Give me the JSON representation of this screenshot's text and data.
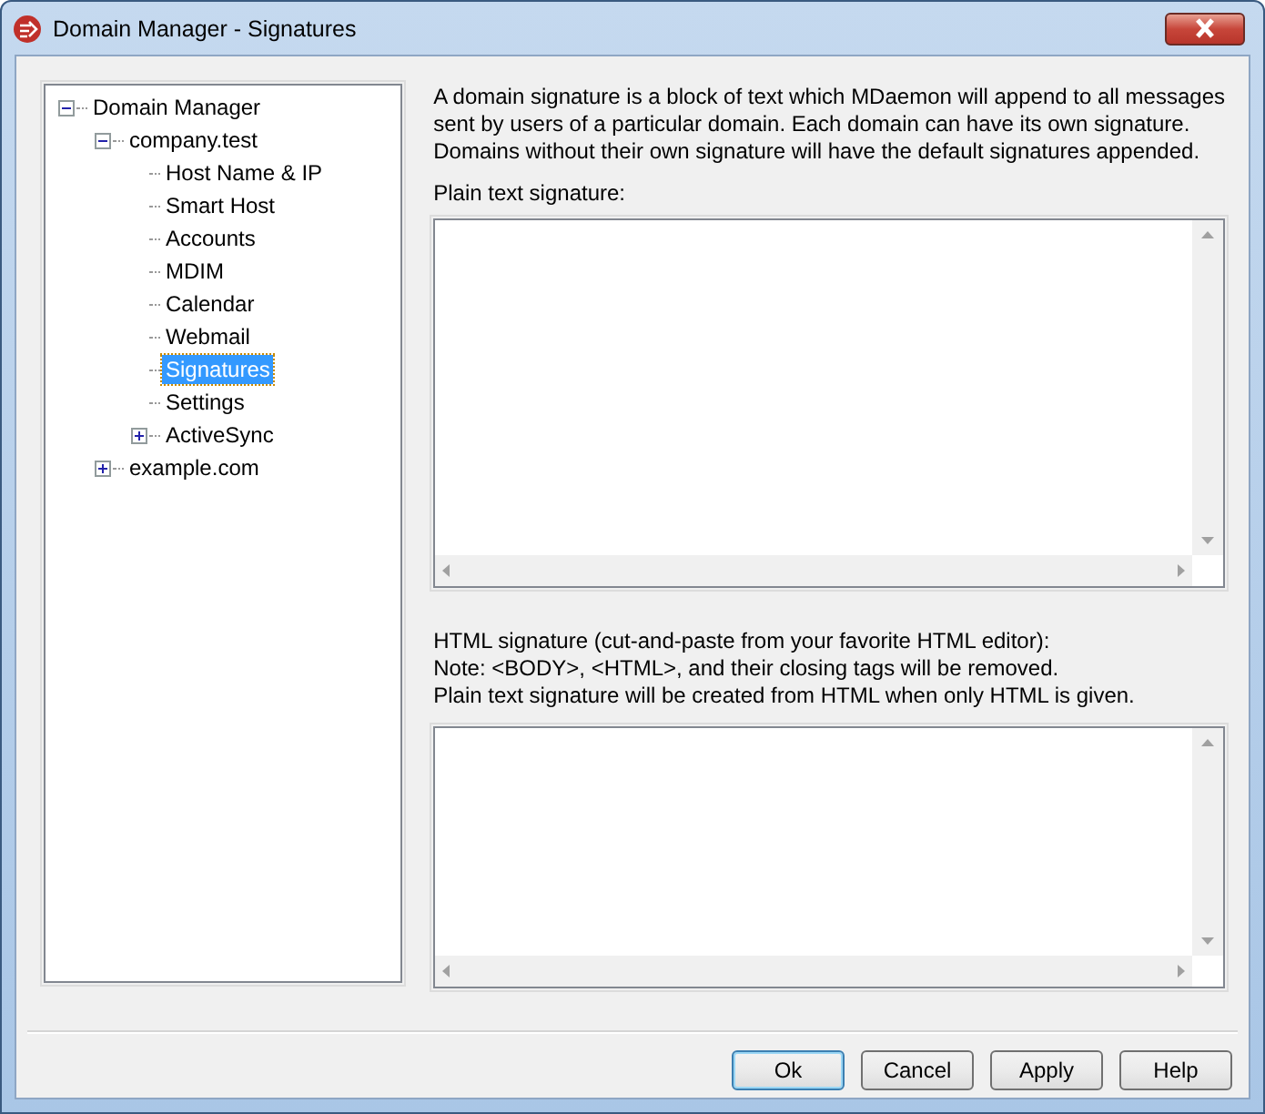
{
  "window": {
    "title": "Domain Manager - Signatures"
  },
  "tree": [
    {
      "label": "Domain Manager",
      "expanded": true,
      "selected": false,
      "children": [
        {
          "label": "company.test",
          "expanded": true,
          "selected": false,
          "children": [
            {
              "label": "Host Name & IP",
              "selected": false
            },
            {
              "label": "Smart Host",
              "selected": false
            },
            {
              "label": "Accounts",
              "selected": false
            },
            {
              "label": "MDIM",
              "selected": false
            },
            {
              "label": "Calendar",
              "selected": false
            },
            {
              "label": "Webmail",
              "selected": false
            },
            {
              "label": "Signatures",
              "selected": true
            },
            {
              "label": "Settings",
              "selected": false
            },
            {
              "label": "ActiveSync",
              "expanded": false,
              "selected": false
            }
          ]
        },
        {
          "label": "example.com",
          "expanded": false,
          "selected": false
        }
      ]
    }
  ],
  "description": [
    "A domain signature is a block of text which MDaemon will append to all messages",
    "sent by users of a particular domain.  Each domain can have its own signature.",
    "Domains without their own signature will have the default signatures appended."
  ],
  "plain_label": "Plain text signature:",
  "html_label": [
    "HTML signature (cut-and-paste from your favorite HTML editor):",
    "Note: <BODY>, <HTML>, and their closing tags will be removed.",
    "Plain text signature will be created from HTML when only HTML is given."
  ],
  "buttons": [
    {
      "label": "Ok",
      "default": true
    },
    {
      "label": "Cancel",
      "default": false
    },
    {
      "label": "Apply",
      "default": false
    },
    {
      "label": "Help",
      "default": false
    }
  ]
}
